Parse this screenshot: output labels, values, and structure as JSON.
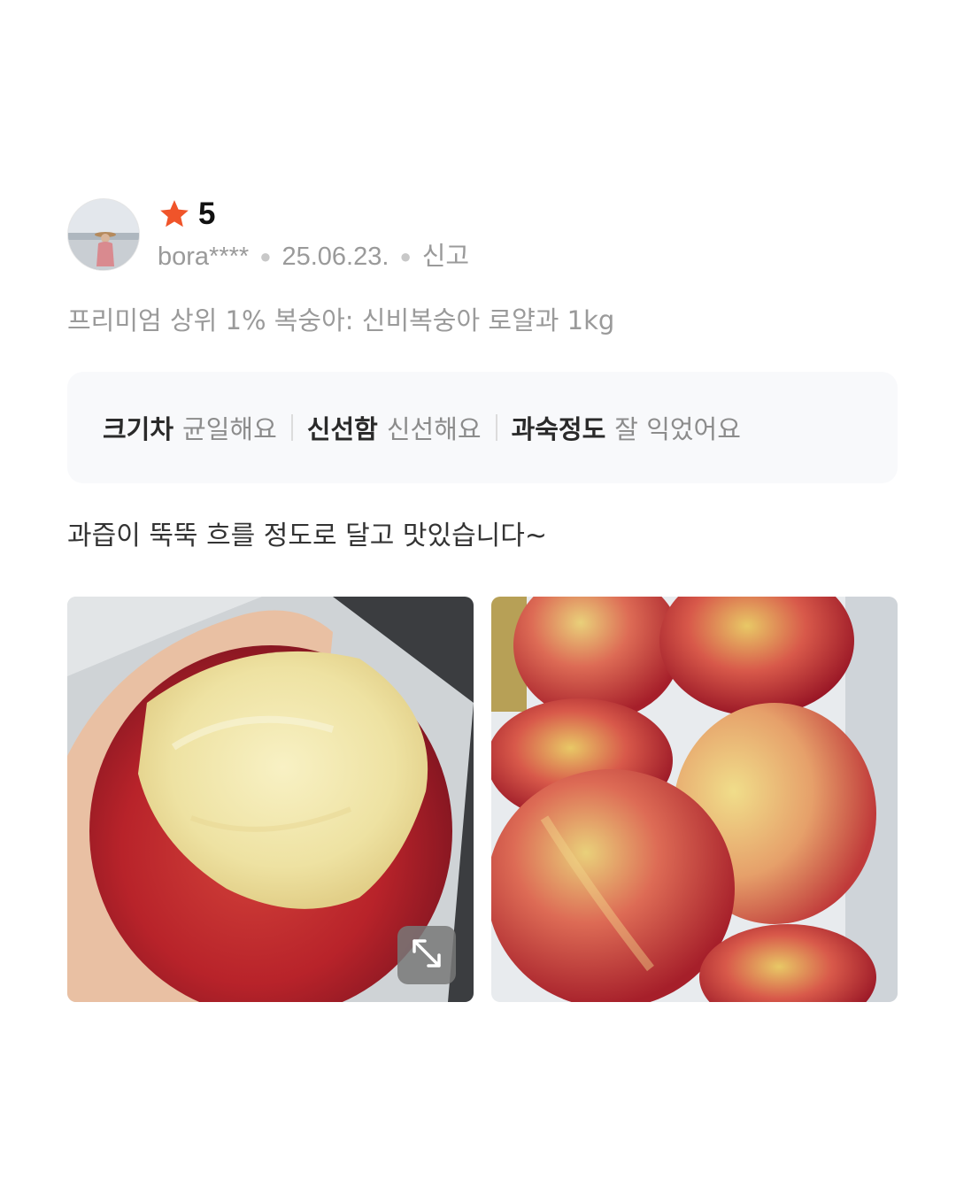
{
  "review": {
    "rating": "5",
    "username": "bora****",
    "date": "25.06.23.",
    "report_label": "신고",
    "product": "프리미엄 상위 1% 복숭아: 신비복숭아 로얄과 1kg",
    "attributes": [
      {
        "key": "크기차",
        "value": "균일해요"
      },
      {
        "key": "신선함",
        "value": "신선해요"
      },
      {
        "key": "과숙정도",
        "value": "잘 익었어요"
      }
    ],
    "body": "과즙이 뚝뚝 흐를 정도로 달고 맛있습니다~",
    "photos": [
      "bitten-peach-photo",
      "peaches-box-photo"
    ]
  },
  "colors": {
    "star": "#f0542a",
    "text_muted": "#9a9a9a",
    "attr_bg": "#f8f9fb"
  },
  "icons": [
    "star-icon",
    "expand-icon"
  ]
}
